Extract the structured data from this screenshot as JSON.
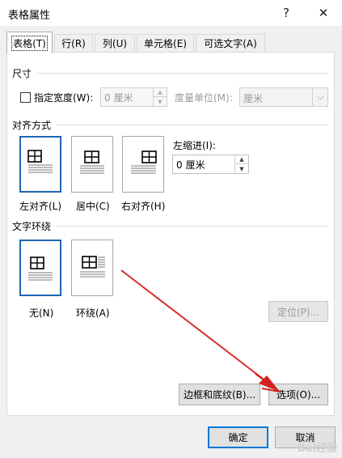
{
  "window": {
    "title": "表格属性",
    "help_glyph": "?",
    "close_glyph": "✕"
  },
  "tabs": [
    {
      "label": "表格(T)",
      "active": true
    },
    {
      "label": "行(R)"
    },
    {
      "label": "列(U)"
    },
    {
      "label": "单元格(E)"
    },
    {
      "label": "可选文字(A)"
    }
  ],
  "size": {
    "section": "尺寸",
    "preferred_width_label": "指定宽度(W):",
    "preferred_width_checked": false,
    "width_value": "0 厘米",
    "measure_label": "度量单位(M):",
    "measure_value": "厘米"
  },
  "alignment": {
    "section": "对齐方式",
    "options": [
      {
        "label": "左对齐(L)",
        "selected": true
      },
      {
        "label": "居中(C)"
      },
      {
        "label": "右对齐(H)"
      }
    ],
    "indent_label": "左缩进(I):",
    "indent_value": "0 厘米"
  },
  "wrapping": {
    "section": "文字环绕",
    "options": [
      {
        "label": "无(N)",
        "selected": true
      },
      {
        "label": "环绕(A)"
      }
    ],
    "position_button": "定位(P)..."
  },
  "buttons": {
    "borders_shading": "边框和底纹(B)...",
    "options": "选项(O)...",
    "ok": "确定",
    "cancel": "取消"
  },
  "watermark": "Bai经验",
  "colors": {
    "accent": "#1e66b4",
    "arrow": "#d42020"
  }
}
